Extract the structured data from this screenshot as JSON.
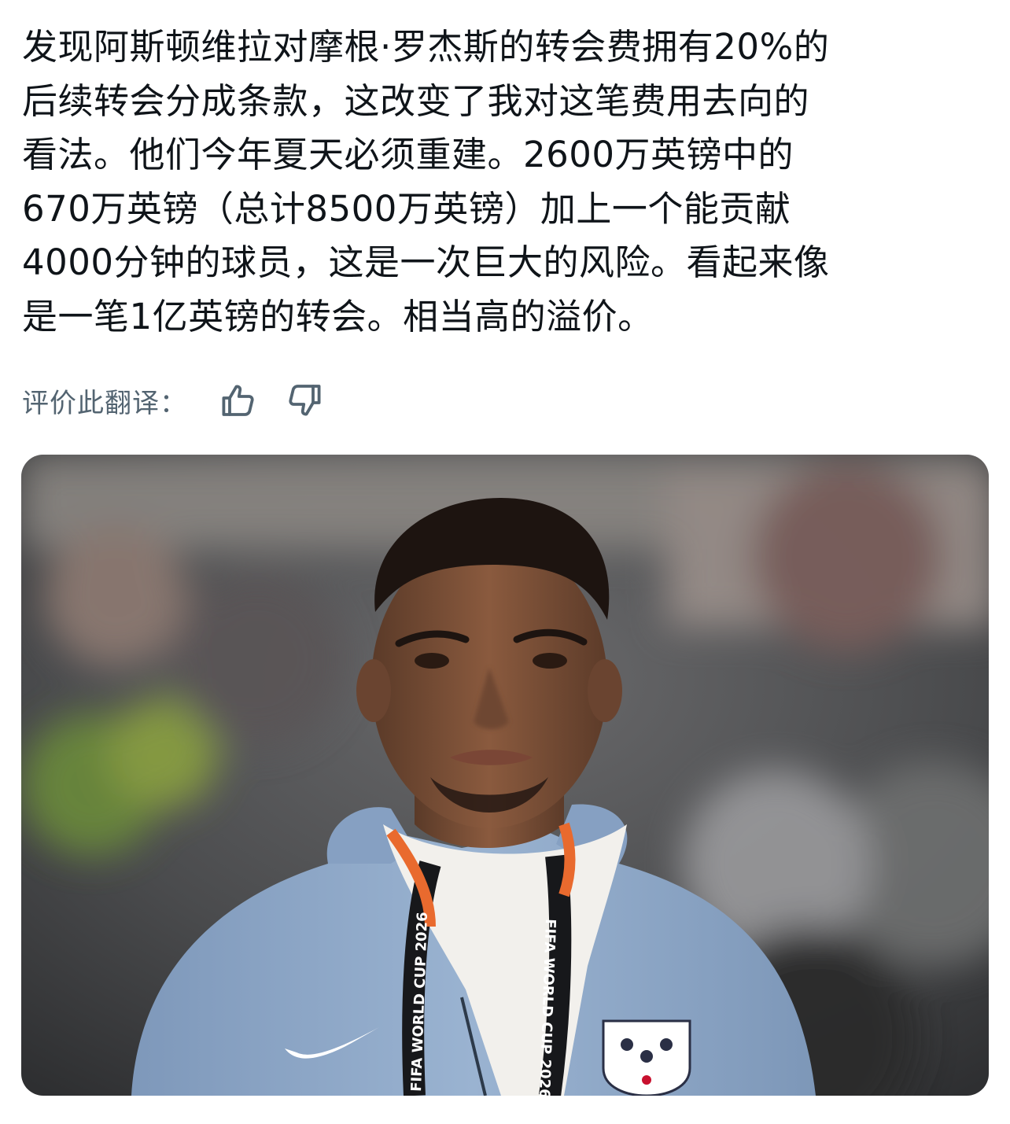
{
  "post": {
    "text_lines": [
      "发现阿斯顿维拉对摩根·罗杰斯的转会费拥有20%的",
      "后续转会分成条款，这改变了我对这笔费用去向的",
      "看法。他们今年夏天必须重建。2600万英镑中的",
      "670万英镑（总计8500万英镑）加上一个能贡献",
      "4000分钟的球员，这是一次巨大的风险。看起来像",
      "是一笔1亿英镑的转会。相当高的溢价。"
    ]
  },
  "translation_rating": {
    "label": "评价此翻译：",
    "thumbs_up_icon": "thumbs-up-icon",
    "thumbs_down_icon": "thumbs-down-icon",
    "icon_color": "#536471"
  },
  "media": {
    "lanyard_text": "FIFA WORLD CUP 2026",
    "colors": {
      "jacket": "#8fa9c9",
      "shirt": "#f2f0ec",
      "background": "#4a4b4d"
    }
  }
}
